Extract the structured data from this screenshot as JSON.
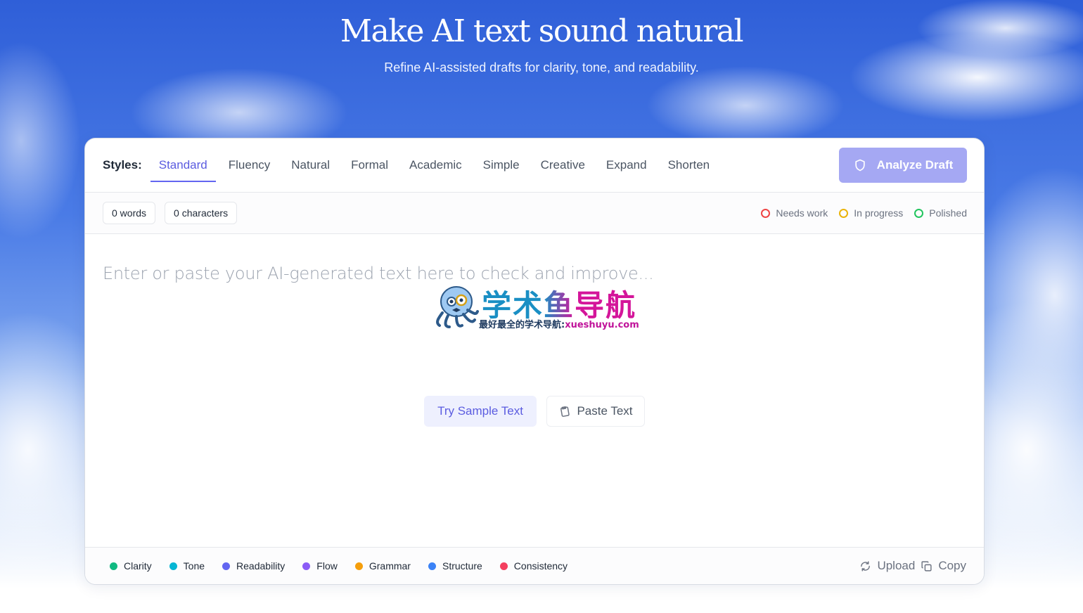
{
  "hero": {
    "title": "Make AI text sound natural",
    "subtitle": "Refine AI-assisted drafts for clarity, tone, and readability."
  },
  "toolbar": {
    "styles_label": "Styles:",
    "tabs": [
      {
        "label": "Standard",
        "active": true
      },
      {
        "label": "Fluency",
        "active": false
      },
      {
        "label": "Natural",
        "active": false
      },
      {
        "label": "Formal",
        "active": false
      },
      {
        "label": "Academic",
        "active": false
      },
      {
        "label": "Simple",
        "active": false
      },
      {
        "label": "Creative",
        "active": false
      },
      {
        "label": "Expand",
        "active": false
      },
      {
        "label": "Shorten",
        "active": false
      }
    ],
    "analyze_label": "Analyze Draft",
    "analyze_icon": "shield-icon"
  },
  "stats": {
    "words": "0 words",
    "characters": "0 characters",
    "statuses": [
      {
        "label": "Needs work",
        "color": "#ef4444"
      },
      {
        "label": "In progress",
        "color": "#eab308"
      },
      {
        "label": "Polished",
        "color": "#22c55e"
      }
    ]
  },
  "editor": {
    "placeholder": "Enter or paste your AI-generated text here to check and improve...",
    "sample_button": "Try Sample Text",
    "paste_button": "Paste Text",
    "paste_icon": "clipboard-icon"
  },
  "watermark": {
    "title": "学术鱼导航",
    "subtitle_cn": "最好最全的学术导航:",
    "subtitle_url": "xueshuyu.com"
  },
  "footer": {
    "metrics": [
      {
        "label": "Clarity",
        "color": "#10b981"
      },
      {
        "label": "Tone",
        "color": "#06b6d4"
      },
      {
        "label": "Readability",
        "color": "#6366f1"
      },
      {
        "label": "Flow",
        "color": "#8b5cf6"
      },
      {
        "label": "Grammar",
        "color": "#f59e0b"
      },
      {
        "label": "Structure",
        "color": "#3b82f6"
      },
      {
        "label": "Consistency",
        "color": "#f43f5e"
      }
    ],
    "upload_label": "Upload",
    "copy_label": "Copy"
  },
  "colors": {
    "accent": "#6366f1",
    "analyze_button": "#a5a8f3"
  }
}
